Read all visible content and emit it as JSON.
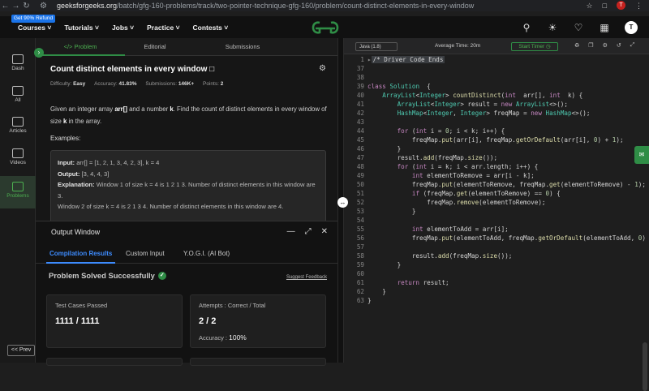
{
  "browser": {
    "url_host": "geeksforgeeks.org",
    "url_path": "/batch/gfg-160-problems/track/two-pointer-technique-gfg-160/problem/count-distinct-elements-in-every-window",
    "profile_initial": "T"
  },
  "promo": {
    "refund_badge": "Get 90% Refund"
  },
  "topnav": {
    "items": [
      "Courses",
      "Tutorials",
      "Jobs",
      "Practice",
      "Contests"
    ],
    "avatar_initial": "T"
  },
  "sidebar": {
    "items": [
      "Dash",
      "All",
      "Articles",
      "Videos",
      "Problems"
    ],
    "prev_label": "<< Prev"
  },
  "problem_tabs": [
    "</> Problem",
    "Editorial",
    "Submissions"
  ],
  "problem": {
    "title": "Count distinct elements in every window",
    "difficulty_label": "Difficulty:",
    "difficulty": "Easy",
    "accuracy_label": "Accuracy:",
    "accuracy": "41.83%",
    "submissions_label": "Submissions:",
    "submissions": "146K+",
    "points_label": "Points:",
    "points": "2",
    "desc_1": "Given an integer array ",
    "desc_arr": "arr[]",
    "desc_2": " and a number ",
    "desc_k": "k",
    "desc_3": ". Find the count of distinct elements in every window of size ",
    "desc_k2": "k",
    "desc_4": " in the array.",
    "examples_label": "Examples:",
    "input_label": "Input:",
    "input_value": " arr[] = [1, 2, 1, 3, 4, 2, 3], k = 4",
    "output_label": "Output:",
    "output_value": " [3, 4, 4, 3]",
    "expl_label": "Explanation:",
    "expl_1": " Window 1 of size k = 4 is 1 2 1 3. Number of distinct elements in this window are 3.",
    "expl_2": "Window 2 of size k = 4 is 2 1 3 4. Number of distinct elements in this window are 4."
  },
  "output": {
    "title": "Output Window",
    "tabs": [
      "Compilation Results",
      "Custom Input",
      "Y.O.G.I. (AI Bot)"
    ],
    "status": "Problem Solved Successfully",
    "feedback": "Suggest Feedback",
    "tests_label": "Test Cases Passed",
    "tests_value": "1111 / 1111",
    "attempts_label": "Attempts : Correct / Total",
    "attempts_value": "2 / 2",
    "accuracy_label": "Accuracy :",
    "accuracy_value": "100%"
  },
  "editor": {
    "language": "Java (1.8)",
    "avg_time": "Average Time: 20m",
    "timer_label": "Start Timer",
    "line_numbers": [
      "1",
      "37",
      "38",
      "39",
      "40",
      "41",
      "42",
      "43",
      "44",
      "45",
      "46",
      "47",
      "48",
      "49",
      "50",
      "51",
      "52",
      "53",
      "54",
      "55",
      "56",
      "57",
      "58",
      "59",
      "60",
      "61",
      "62",
      "63"
    ]
  }
}
